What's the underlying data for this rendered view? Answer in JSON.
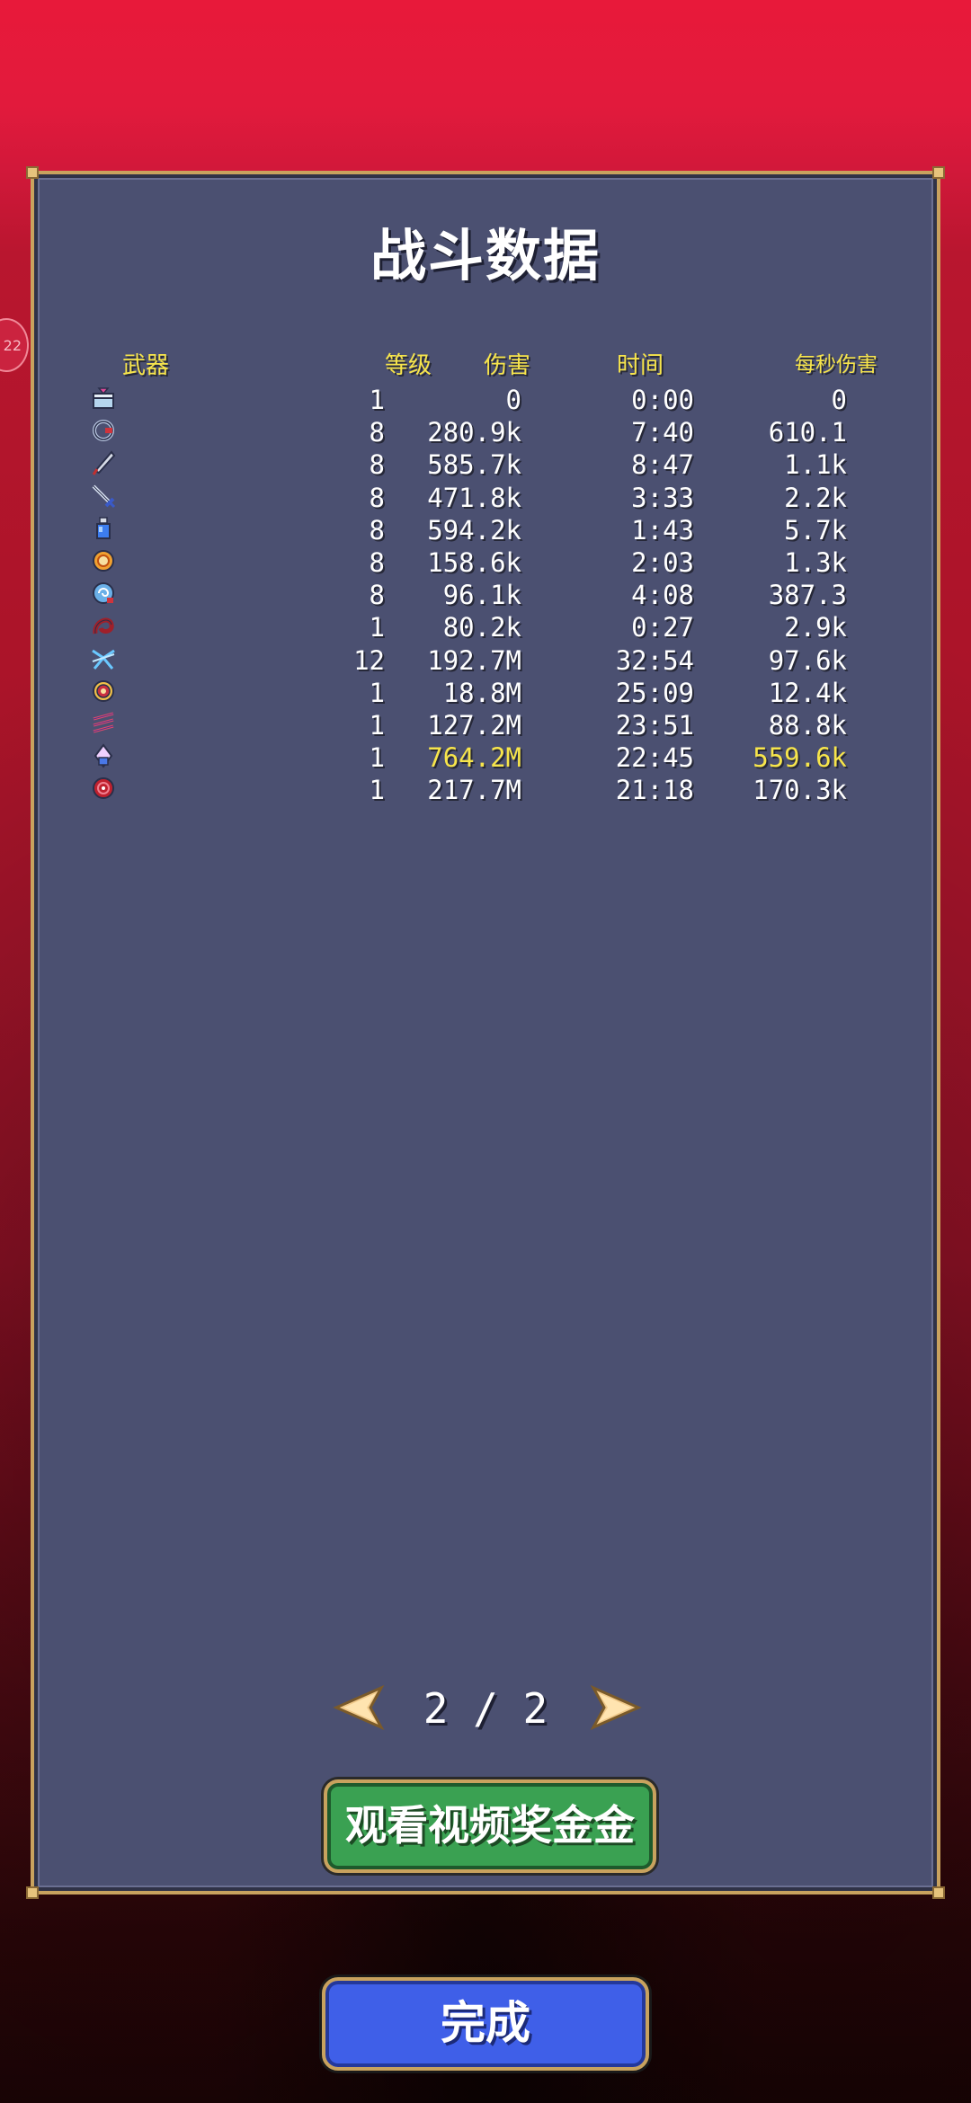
{
  "side_badge": "22",
  "title": "战斗数据",
  "headers": {
    "weapon": "武器",
    "level": "等级",
    "damage": "伤害",
    "time": "时间",
    "dps": "每秒伤害"
  },
  "rows": [
    {
      "icon": "gift-box-icon",
      "level": "1",
      "damage": "0",
      "time": "0:00",
      "dps": "0",
      "highlight": false
    },
    {
      "icon": "ring-blade-icon",
      "level": "8",
      "damage": "280.9k",
      "time": "7:40",
      "dps": "610.1",
      "highlight": false
    },
    {
      "icon": "feather-quill-icon",
      "level": "8",
      "damage": "585.7k",
      "time": "8:47",
      "dps": "1.1k",
      "highlight": false
    },
    {
      "icon": "sword-icon",
      "level": "8",
      "damage": "471.8k",
      "time": "3:33",
      "dps": "2.2k",
      "highlight": false
    },
    {
      "icon": "potion-bottle-icon",
      "level": "8",
      "damage": "594.2k",
      "time": "1:43",
      "dps": "5.7k",
      "highlight": false
    },
    {
      "icon": "orbit-ring-icon",
      "level": "8",
      "damage": "158.6k",
      "time": "2:03",
      "dps": "1.3k",
      "highlight": false
    },
    {
      "icon": "spiral-orb-icon",
      "level": "8",
      "damage": "96.1k",
      "time": "4:08",
      "dps": "387.3",
      "highlight": false
    },
    {
      "icon": "blood-whip-icon",
      "level": "1",
      "damage": "80.2k",
      "time": "0:27",
      "dps": "2.9k",
      "highlight": false
    },
    {
      "icon": "lightning-cross-icon",
      "level": "12",
      "damage": "192.7M",
      "time": "32:54",
      "dps": "97.6k",
      "highlight": false
    },
    {
      "icon": "target-ring-icon",
      "level": "1",
      "damage": "18.8M",
      "time": "25:09",
      "dps": "12.4k",
      "highlight": false
    },
    {
      "icon": "triple-slash-icon",
      "level": "1",
      "damage": "127.2M",
      "time": "23:51",
      "dps": "88.8k",
      "highlight": false
    },
    {
      "icon": "holy-flask-icon",
      "level": "1",
      "damage": "764.2M",
      "time": "22:45",
      "dps": "559.6k",
      "highlight": true
    },
    {
      "icon": "crimson-orb-icon",
      "level": "1",
      "damage": "217.7M",
      "time": "21:18",
      "dps": "170.3k",
      "highlight": false
    }
  ],
  "pager": {
    "text": "2 / 2",
    "prev_icon": "arrow-left-icon",
    "next_icon": "arrow-right-icon"
  },
  "video_button": "观看视频奖金金",
  "done_button": "完成",
  "colors": {
    "panel": "#4b5071",
    "border_gold": "#c8a25e",
    "header_yellow": "#f7e54b",
    "video_green": "#3aa152",
    "done_blue": "#3f5fe8",
    "background_red": "#e21a3c"
  }
}
